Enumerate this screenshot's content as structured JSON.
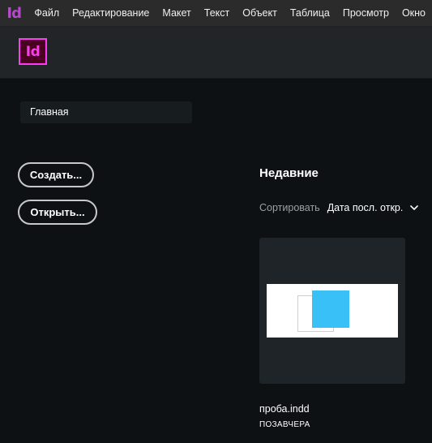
{
  "app": {
    "mini_logo": "Id",
    "logo": "Id",
    "logo_color": "#ff3af2",
    "logo_bg": "#49021f"
  },
  "menu": {
    "items": [
      "Файл",
      "Редактирование",
      "Макет",
      "Текст",
      "Объект",
      "Таблица",
      "Просмотр",
      "Окно"
    ]
  },
  "sidebar": {
    "home_label": "Главная",
    "create_label": "Создать...",
    "open_label": "Открыть..."
  },
  "recent": {
    "title": "Недавние",
    "sort_label": "Сортировать",
    "sort_value": "Дата посл. откр.",
    "sort_icon": "chevron-down-icon",
    "files": [
      {
        "name": "проба.indd",
        "date": "ПОЗАВЧЕРА",
        "thumb_accent": "#39c0f6"
      }
    ]
  }
}
